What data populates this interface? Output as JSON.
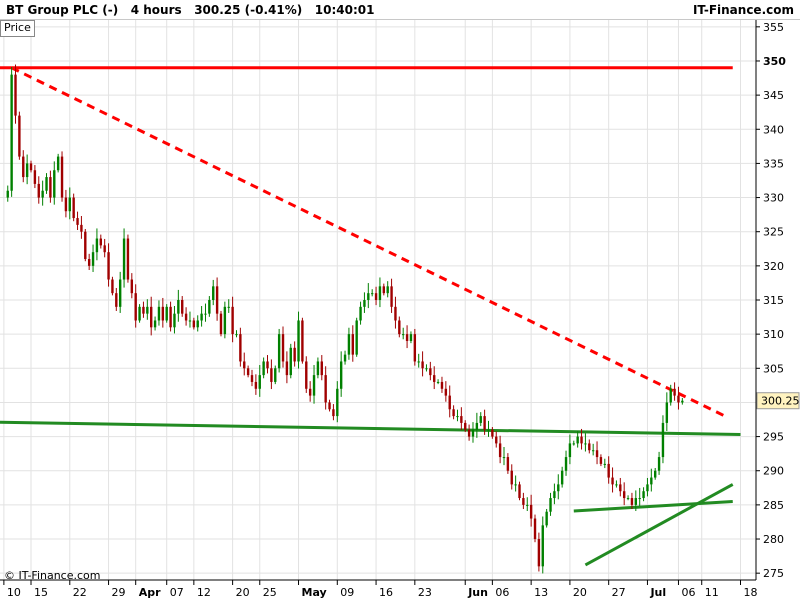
{
  "header": {
    "left": "BT Group PLC (-)   4 hours   300.25 (-0.41%)   10:40:01",
    "right": "IT-Finance.com"
  },
  "price_tag": "Price",
  "copyright": "© IT-Finance.com",
  "colors": {
    "up": "#008000",
    "down": "#a00000",
    "resistance": "#ff0000",
    "trendline_dashed": "#ff0000",
    "support": "#228b22",
    "grid": "#e2e2e2",
    "current_label_bg": "#fff3c0"
  },
  "chart_data": {
    "type": "candlestick",
    "symbol": "BT Group PLC",
    "interval": "4 hours",
    "last_price": 300.25,
    "current_price_label": "300.25",
    "ylim": [
      274,
      356
    ],
    "y_ticks": [
      275,
      280,
      285,
      290,
      295,
      300,
      305,
      310,
      315,
      320,
      325,
      330,
      335,
      340,
      345,
      350,
      355
    ],
    "x_ticks": [
      {
        "label": "10",
        "i": 0
      },
      {
        "label": "15",
        "i": 7
      },
      {
        "label": "22",
        "i": 17
      },
      {
        "label": "29",
        "i": 27
      },
      {
        "label": "Apr",
        "i": 34,
        "month": true
      },
      {
        "label": "07",
        "i": 42
      },
      {
        "label": "12",
        "i": 49
      },
      {
        "label": "20",
        "i": 59
      },
      {
        "label": "25",
        "i": 66
      },
      {
        "label": "May",
        "i": 76,
        "month": true
      },
      {
        "label": "09",
        "i": 86
      },
      {
        "label": "16",
        "i": 96
      },
      {
        "label": "23",
        "i": 106
      },
      {
        "label": "Jun",
        "i": 119,
        "month": true
      },
      {
        "label": "06",
        "i": 126
      },
      {
        "label": "13",
        "i": 136
      },
      {
        "label": "20",
        "i": 146
      },
      {
        "label": "27",
        "i": 156
      },
      {
        "label": "Jul",
        "i": 166,
        "month": true
      },
      {
        "label": "06",
        "i": 174
      },
      {
        "label": "11",
        "i": 180
      },
      {
        "label": "18",
        "i": 190
      }
    ],
    "x_range": [
      -1,
      194
    ],
    "closes": [
      330,
      331,
      348,
      342,
      336,
      333,
      335,
      334,
      332,
      330,
      331,
      333,
      330,
      334,
      336,
      330,
      328,
      330,
      327,
      326,
      325,
      321,
      320,
      322,
      324,
      323,
      322,
      318,
      316,
      314,
      318,
      324,
      318,
      316,
      312,
      314,
      313,
      314,
      311,
      312,
      314,
      312,
      314,
      311,
      313,
      315,
      313,
      312,
      312,
      311,
      312,
      313,
      313,
      315,
      317,
      313,
      310,
      314,
      314,
      310,
      310,
      306,
      305,
      304,
      303,
      302,
      304,
      306,
      305,
      303,
      305,
      310,
      306,
      304,
      308,
      306,
      312,
      306,
      302,
      301,
      304,
      306,
      304,
      300,
      299,
      298,
      302,
      306,
      307,
      310,
      307,
      312,
      314,
      315,
      316,
      316,
      315,
      317,
      316,
      317,
      314,
      312,
      310,
      310,
      309,
      310,
      306,
      306,
      305,
      305,
      304,
      303,
      303,
      302,
      301,
      299,
      298,
      298,
      297,
      296,
      295,
      296,
      297,
      298,
      296,
      296,
      295,
      294,
      292,
      292,
      290,
      288,
      288,
      286,
      285,
      285,
      283,
      280,
      276,
      282,
      284,
      286,
      287,
      288,
      290,
      292,
      294,
      294,
      295,
      294,
      294,
      293,
      293,
      292,
      291,
      291,
      289,
      288,
      288,
      287,
      286,
      286,
      285,
      286,
      286,
      287,
      288,
      289,
      290,
      292,
      297,
      300,
      302,
      301,
      300,
      300.25
    ],
    "horizontal_lines": [
      {
        "name": "resistance",
        "y": 349,
        "x0": -1,
        "x1": 188,
        "style": "solid"
      }
    ],
    "trend_lines": [
      {
        "name": "downtrend",
        "x0": 2,
        "y0": 349,
        "x1": 186,
        "y1": 298,
        "style": "dashed"
      },
      {
        "name": "neckline",
        "x0": -1,
        "y0": 297.1,
        "x1": 190,
        "y1": 295.3,
        "style": "solid"
      },
      {
        "name": "range-floor",
        "x0": 147,
        "y0": 284.1,
        "x1": 188,
        "y1": 285.5,
        "style": "solid"
      },
      {
        "name": "uptrend",
        "x0": 150,
        "y0": 276.2,
        "x1": 188,
        "y1": 288.0,
        "style": "solid"
      }
    ]
  }
}
